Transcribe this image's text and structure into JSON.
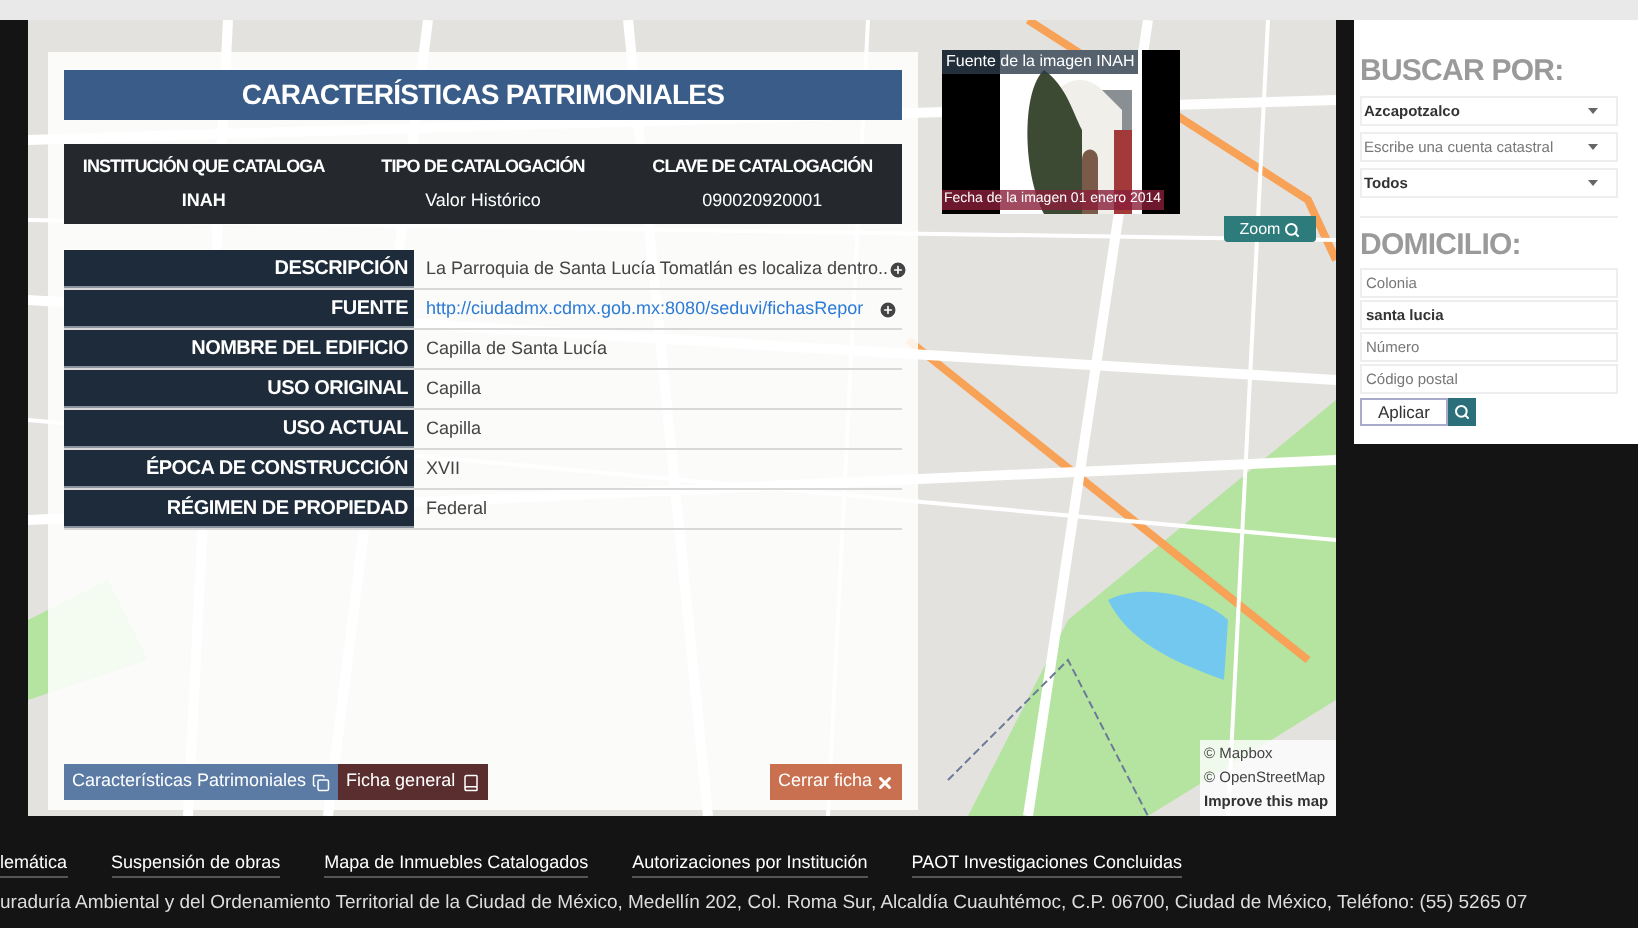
{
  "panel": {
    "title": "CARACTERÍSTICAS PATRIMONIALES",
    "catalog": {
      "columns": [
        "INSTITUCIÓN QUE CATALOGA",
        "TIPO DE CATALOGACIÓN",
        "CLAVE DE CATALOGACIÓN"
      ],
      "row": [
        "INAH",
        "Valor Histórico",
        "090020920001"
      ]
    },
    "details": [
      {
        "label": "DESCRIPCIÓN",
        "value": "La Parroquia de Santa Lucía Tomatlán es localiza dentro..",
        "kind": "text",
        "expandable": true
      },
      {
        "label": "FUENTE",
        "value": "http://ciudadmx.cdmx.gob.mx:8080/seduvi/fichasRepor",
        "kind": "link",
        "expandable": true
      },
      {
        "label": "NOMBRE DEL EDIFICIO",
        "value": "Capilla de Santa Lucía",
        "kind": "text",
        "expandable": false
      },
      {
        "label": "USO ORIGINAL",
        "value": "Capilla",
        "kind": "text",
        "expandable": false
      },
      {
        "label": "USO ACTUAL",
        "value": "Capilla",
        "kind": "text",
        "expandable": false
      },
      {
        "label": "ÉPOCA DE CONSTRUCCIÓN",
        "value": "XVII",
        "kind": "text",
        "expandable": false
      },
      {
        "label": "RÉGIMEN DE PROPIEDAD",
        "value": "Federal",
        "kind": "text",
        "expandable": false
      }
    ],
    "tabs": [
      {
        "label": "Características Patrimoniales",
        "selected": true
      },
      {
        "label": "Ficha general",
        "selected": false
      }
    ],
    "close_button": "Cerrar ficha"
  },
  "image": {
    "source": "Fuente de la imagen INAH",
    "date": "Fecha de la imagen 01 enero 2014",
    "zoom": "Zoom"
  },
  "map_attribution": [
    "© Mapbox",
    "© OpenStreetMap",
    "Improve this map"
  ],
  "search": {
    "title": "BUSCAR POR:",
    "selects": [
      {
        "value": "Azcapotzalco"
      },
      {
        "placeholder": "Escribe una cuenta catastral"
      },
      {
        "value": "Todos"
      }
    ]
  },
  "address": {
    "title": "DOMICILIO:",
    "fields": [
      {
        "placeholder": "Colonia"
      },
      {
        "value": "santa lucia"
      },
      {
        "placeholder": "Número"
      },
      {
        "placeholder": "Código postal"
      }
    ],
    "apply": "Aplicar"
  },
  "footer": {
    "links": [
      "lemática",
      "Suspensión de obras",
      "Mapa de Inmuebles Catalogados",
      "Autorizaciones por Institución",
      "PAOT Investigaciones Concluidas"
    ],
    "address": "uraduría Ambiental y del Ordenamiento Territorial de la Ciudad de México, Medellín 202, Col. Roma Sur, Alcaldía Cuauhtémoc, C.P. 06700, Ciudad de México, Teléfono: (55) 5265 07"
  }
}
